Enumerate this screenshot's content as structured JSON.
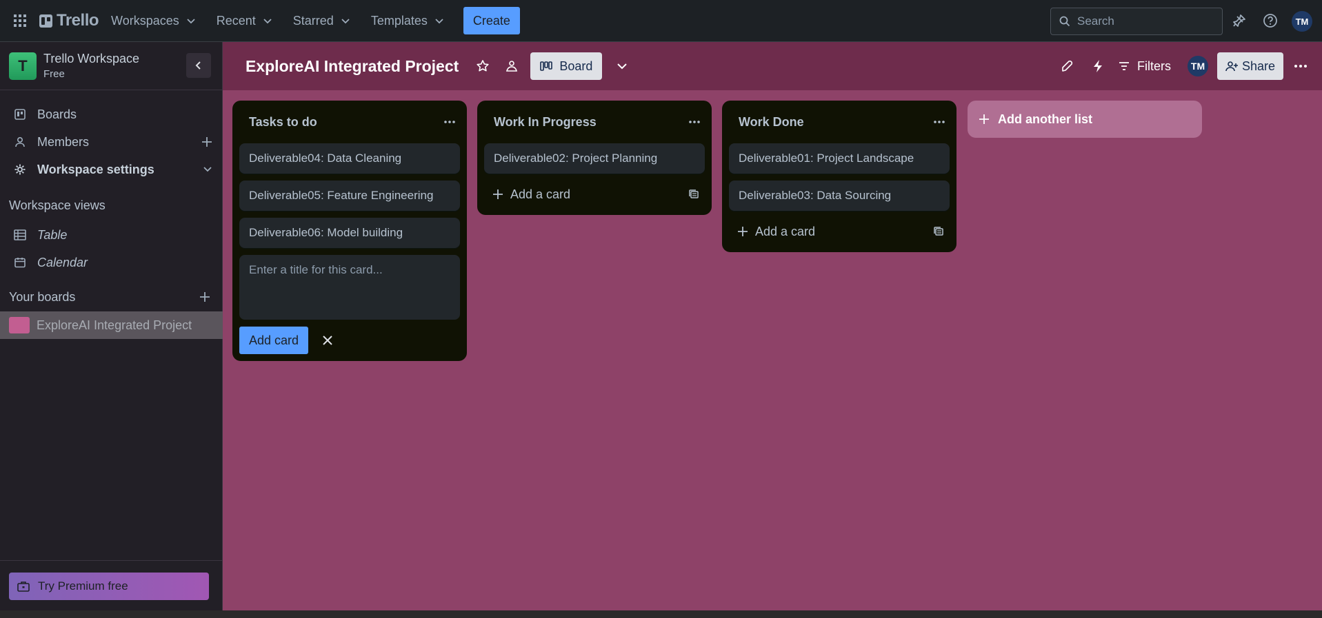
{
  "topbar": {
    "logo": "Trello",
    "nav": [
      {
        "label": "Workspaces"
      },
      {
        "label": "Recent"
      },
      {
        "label": "Starred"
      },
      {
        "label": "Templates"
      }
    ],
    "create_label": "Create",
    "search_placeholder": "Search",
    "avatar_initials": "TM"
  },
  "sidebar": {
    "workspace_initial": "T",
    "workspace_name": "Trello Workspace",
    "workspace_plan": "Free",
    "items": [
      {
        "label": "Boards",
        "icon": "board-icon"
      },
      {
        "label": "Members",
        "icon": "person-icon"
      },
      {
        "label": "Workspace settings",
        "icon": "gear-icon"
      }
    ],
    "views_heading": "Workspace views",
    "views": [
      {
        "label": "Table",
        "icon": "table-icon"
      },
      {
        "label": "Calendar",
        "icon": "calendar-icon"
      }
    ],
    "boards_heading": "Your boards",
    "boards": [
      {
        "label": "ExploreAI Integrated Project",
        "color": "#c25e91"
      }
    ],
    "premium_label": "Try Premium free"
  },
  "board": {
    "title": "ExploreAI Integrated Project",
    "view_label": "Board",
    "filters_label": "Filters",
    "share_label": "Share",
    "member_initials": "TM",
    "background_color": "#8e4268",
    "lists": [
      {
        "title": "Tasks to do",
        "cards": [
          "Deliverable04: Data Cleaning",
          "Deliverable05: Feature Engineering",
          "Deliverable06: Model building"
        ],
        "composer_placeholder": "Enter a title for this card...",
        "composer_button": "Add card"
      },
      {
        "title": "Work In Progress",
        "cards": [
          "Deliverable02: Project Planning"
        ],
        "add_card_label": "Add a card"
      },
      {
        "title": "Work Done",
        "cards": [
          "Deliverable01: Project Landscape",
          "Deliverable03: Data Sourcing"
        ],
        "add_card_label": "Add a card"
      }
    ],
    "add_list_label": "Add another list"
  },
  "colors": {
    "accent": "#579dff",
    "topbar": "#1d2125",
    "sidebar": "#221f26",
    "boardbar": "#6e2c4c"
  }
}
